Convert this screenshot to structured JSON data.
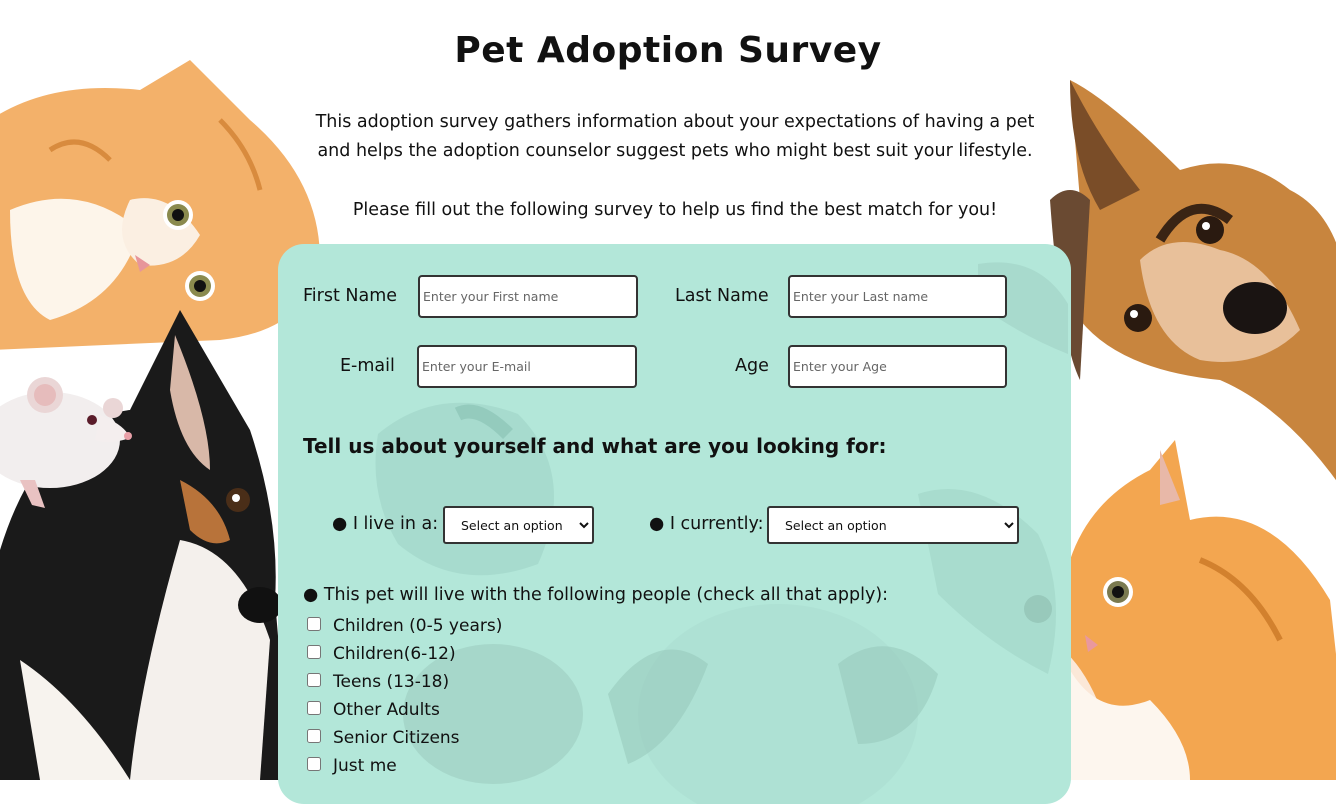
{
  "header": {
    "title": "Pet Adoption Survey",
    "intro": "This adoption survey gathers information about your expectations of having a pet and helps the adoption counselor suggest pets who might best suit your lifestyle.",
    "instructions": "Please fill out the following survey to help us find the best match for you!"
  },
  "form": {
    "first_name": {
      "label": "First Name",
      "placeholder": "Enter your First name"
    },
    "last_name": {
      "label": "Last Name",
      "placeholder": "Enter your Last name"
    },
    "email": {
      "label": "E-mail",
      "placeholder": "Enter your E-mail"
    },
    "age": {
      "label": "Age",
      "placeholder": "Enter your Age"
    },
    "section_heading": "Tell us about yourself and what are you looking for:",
    "live_in": {
      "label": "● I live in a:",
      "selected": "Select an option"
    },
    "currently": {
      "label": "● I currently:",
      "selected": "Select an option"
    },
    "people": {
      "question": "● This pet will live with the following people (check all that apply):",
      "options": [
        "Children (0-5 years)",
        "Children(6-12)",
        "Teens (13-18)",
        "Other Adults",
        "Senior Citizens",
        "Just me"
      ]
    }
  },
  "colors": {
    "card_background": "#b3e7d9",
    "field_border": "#333333"
  },
  "icons": [
    "kitten-illustration",
    "mouse-illustration",
    "dog-illustration",
    "dog-illustration",
    "kitten-illustration"
  ]
}
